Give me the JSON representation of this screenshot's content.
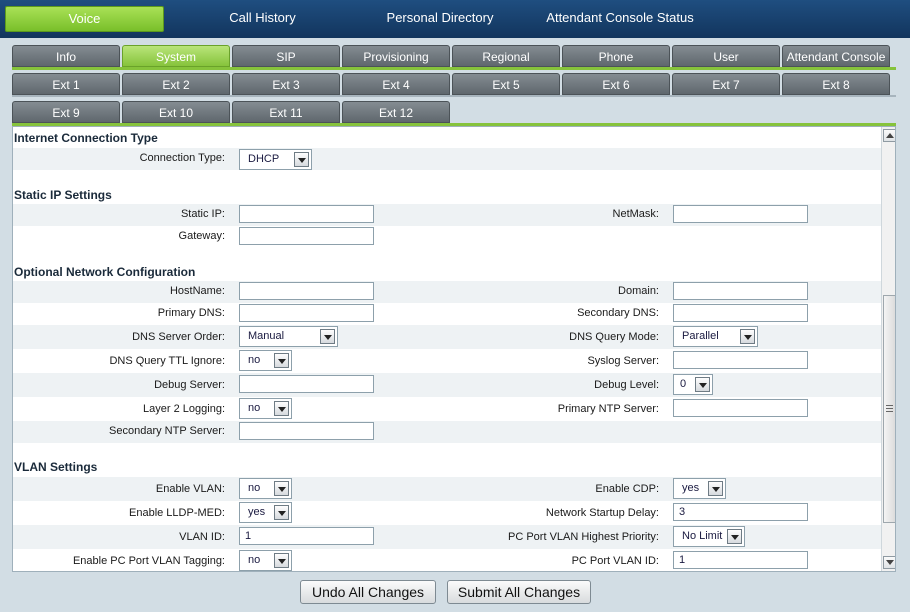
{
  "topnav": {
    "voice": "Voice",
    "call_history": "Call History",
    "personal_directory": "Personal Directory",
    "attendant_console_status": "Attendant Console Status"
  },
  "tabs": {
    "row1": [
      "Info",
      "System",
      "SIP",
      "Provisioning",
      "Regional",
      "Phone",
      "User",
      "Attendant Console"
    ],
    "row2": [
      "Ext 1",
      "Ext 2",
      "Ext 3",
      "Ext 4",
      "Ext 5",
      "Ext 6",
      "Ext 7",
      "Ext 8"
    ],
    "row3": [
      "Ext 9",
      "Ext 10",
      "Ext 11",
      "Ext 12"
    ],
    "active": "System"
  },
  "internet": {
    "heading": "Internet Connection Type",
    "connection_type_label": "Connection Type:",
    "connection_type_value": "DHCP"
  },
  "static_ip": {
    "heading": "Static IP Settings",
    "static_ip_label": "Static IP:",
    "static_ip_value": "",
    "netmask_label": "NetMask:",
    "netmask_value": "",
    "gateway_label": "Gateway:",
    "gateway_value": ""
  },
  "optional": {
    "heading": "Optional Network Configuration",
    "hostname_label": "HostName:",
    "hostname_value": "",
    "domain_label": "Domain:",
    "domain_value": "",
    "primary_dns_label": "Primary DNS:",
    "primary_dns_value": "",
    "secondary_dns_label": "Secondary DNS:",
    "secondary_dns_value": "",
    "dns_server_order_label": "DNS Server Order:",
    "dns_server_order_value": "Manual",
    "dns_query_mode_label": "DNS Query Mode:",
    "dns_query_mode_value": "Parallel",
    "dns_ttl_ignore_label": "DNS Query TTL Ignore:",
    "dns_ttl_ignore_value": "no",
    "syslog_server_label": "Syslog Server:",
    "syslog_server_value": "",
    "debug_server_label": "Debug Server:",
    "debug_server_value": "",
    "debug_level_label": "Debug Level:",
    "debug_level_value": "0",
    "layer2_logging_label": "Layer 2 Logging:",
    "layer2_logging_value": "no",
    "primary_ntp_label": "Primary NTP Server:",
    "primary_ntp_value": "",
    "secondary_ntp_label": "Secondary NTP Server:",
    "secondary_ntp_value": ""
  },
  "vlan": {
    "heading": "VLAN Settings",
    "enable_vlan_label": "Enable VLAN:",
    "enable_vlan_value": "no",
    "enable_cdp_label": "Enable CDP:",
    "enable_cdp_value": "yes",
    "enable_lldp_label": "Enable LLDP-MED:",
    "enable_lldp_value": "yes",
    "startup_delay_label": "Network Startup Delay:",
    "startup_delay_value": "3",
    "vlan_id_label": "VLAN ID:",
    "vlan_id_value": "1",
    "pc_vlan_priority_label": "PC Port VLAN Highest Priority:",
    "pc_vlan_priority_value": "No Limit",
    "pc_vlan_tagging_label": "Enable PC Port VLAN Tagging:",
    "pc_vlan_tagging_value": "no",
    "pc_vlan_id_label": "PC Port VLAN ID:",
    "pc_vlan_id_value": "1"
  },
  "actions": {
    "undo": "Undo All Changes",
    "submit": "Submit All Changes"
  }
}
